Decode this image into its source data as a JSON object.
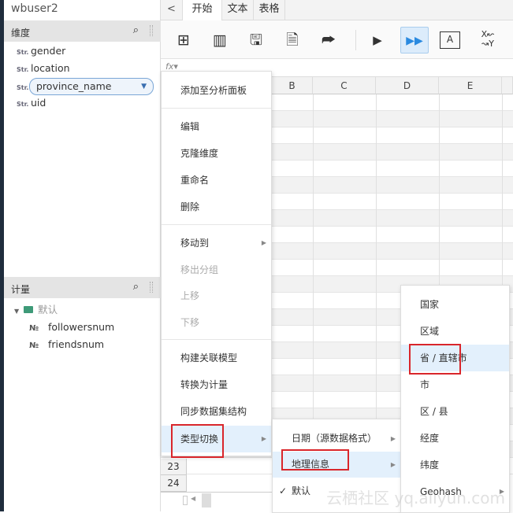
{
  "dataset_title": "wbuser2",
  "dimensions": {
    "header": "维度",
    "items": [
      {
        "type": "Str.",
        "name": "gender"
      },
      {
        "type": "Str.",
        "name": "location"
      },
      {
        "type": "Str.",
        "name": "province_name",
        "selected": true
      },
      {
        "type": "Str.",
        "name": "uid"
      }
    ]
  },
  "measures": {
    "header": "计量",
    "folder": "默认",
    "items": [
      {
        "type": "№",
        "name": "followersnum"
      },
      {
        "type": "№",
        "name": "friendsnum"
      }
    ]
  },
  "tabs": {
    "back": "<",
    "items": [
      "开始",
      "文本",
      "表格"
    ],
    "active": 0
  },
  "toolbar": {
    "icons": [
      "add-table-icon",
      "add-chart-icon",
      "save-icon",
      "save-as-icon",
      "share-icon",
      "run-icon",
      "run-all-icon",
      "text-format-icon",
      "swap-xy-icon"
    ],
    "active": "run-all-icon"
  },
  "formula": {
    "fx": "fx▾"
  },
  "grid": {
    "columns": [
      "B",
      "C",
      "D",
      "E"
    ],
    "row_numbers": [
      "23",
      "24"
    ]
  },
  "context_menu": {
    "items": [
      {
        "label": "添加至分析面板"
      },
      {
        "label": "编辑"
      },
      {
        "label": "克隆维度"
      },
      {
        "label": "重命名"
      },
      {
        "label": "删除"
      },
      {
        "label": "移动到",
        "submenu": true
      },
      {
        "label": "移出分组",
        "disabled": true
      },
      {
        "label": "上移",
        "disabled": true
      },
      {
        "label": "下移",
        "disabled": true
      },
      {
        "label": "构建关联模型"
      },
      {
        "label": "转换为计量"
      },
      {
        "label": "同步数据集结构"
      },
      {
        "label": "类型切换",
        "submenu": true,
        "highlighted": true
      }
    ]
  },
  "type_submenu": {
    "items": [
      {
        "label": "日期（源数据格式）",
        "submenu": true
      },
      {
        "label": "地理信息",
        "submenu": true,
        "highlighted": true
      },
      {
        "label": "默认",
        "checked": true
      }
    ]
  },
  "geo_submenu": {
    "items": [
      {
        "label": "国家"
      },
      {
        "label": "区域"
      },
      {
        "label": "省 / 直辖市",
        "highlighted": true
      },
      {
        "label": "市"
      },
      {
        "label": "区 / 县"
      },
      {
        "label": "经度"
      },
      {
        "label": "纬度"
      },
      {
        "label": "Geohash",
        "submenu": true
      }
    ]
  },
  "watermark": "云栖社区 yq.aliyun.com",
  "colors": {
    "highlight": "#e3f0fc",
    "annotation_box": "#d9262b",
    "sidebar_stripe": "#1f2d3d"
  }
}
